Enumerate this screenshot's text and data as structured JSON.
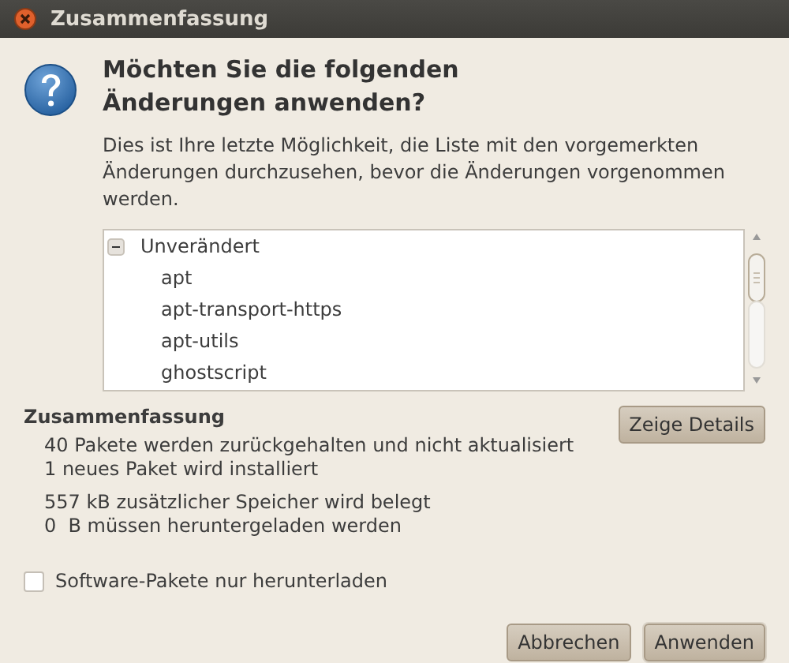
{
  "window": {
    "title": "Zusammenfassung"
  },
  "heading": "Möchten Sie die folgenden Änderungen anwenden?",
  "description": "Dies ist Ihre letzte Möglichkeit, die Liste mit den vorgemerkten Änderungen durchzusehen, bevor die Änderungen vorgenommen werden.",
  "tree": [
    {
      "label": "Unverändert",
      "expanded": true,
      "children": [
        {
          "label": "apt"
        },
        {
          "label": "apt-transport-https"
        },
        {
          "label": "apt-utils"
        },
        {
          "label": "ghostscript"
        }
      ]
    }
  ],
  "summary": {
    "title": "Zusammenfassung",
    "groups": [
      [
        "40 Pakete werden zurückgehalten und nicht aktualisiert",
        "1 neues Paket wird installiert"
      ],
      [
        "557 kB zusätzlicher Speicher wird belegt",
        "0  B müssen heruntergeladen werden"
      ]
    ]
  },
  "details_button": "Zeige Details",
  "download_only": {
    "label": "Software-Pakete nur herunterladen",
    "checked": false
  },
  "buttons": [
    {
      "label": "Abbrechen"
    },
    {
      "label": "Anwenden"
    }
  ]
}
